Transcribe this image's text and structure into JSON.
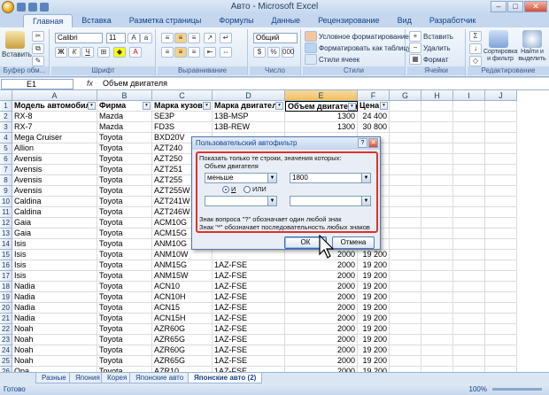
{
  "window": {
    "title": "Авто - Microsoft Excel"
  },
  "ribbon": {
    "tabs": [
      "Главная",
      "Вставка",
      "Разметка страницы",
      "Формулы",
      "Данные",
      "Рецензирование",
      "Вид",
      "Разработчик"
    ],
    "clipboard": {
      "paste": "Вставить",
      "group": "Буфер обм..."
    },
    "font": {
      "name": "Calibri",
      "size": "11",
      "group": "Шрифт"
    },
    "align": {
      "group": "Выравнивание"
    },
    "number": {
      "format": "Общий",
      "group": "Число"
    },
    "styles": {
      "cond": "Условное форматирование",
      "table": "Форматировать как таблицу",
      "cell": "Стили ячеек",
      "group": "Стили"
    },
    "cells": {
      "insert": "Вставить",
      "delete": "Удалить",
      "format": "Формат",
      "group": "Ячейки"
    },
    "edit": {
      "sort": "Сортировка и фильтр",
      "find": "Найти и выделить",
      "group": "Редактирование"
    }
  },
  "formula_bar": {
    "cell": "E1",
    "fx": "fx",
    "value": "Объем двигателя"
  },
  "columns": [
    "A",
    "B",
    "C",
    "D",
    "E",
    "F",
    "G",
    "H",
    "I",
    "J"
  ],
  "headers": [
    "Модель автомобиля",
    "Фирма",
    "Марка кузова",
    "Марка двигателя",
    "Объем двигателя",
    "Цена"
  ],
  "rows": [
    [
      "RX-8",
      "Mazda",
      "SE3P",
      "13B-MSP",
      "1300",
      "24 400"
    ],
    [
      "RX-7",
      "Mazda",
      "FD3S",
      "13B-REW",
      "1300",
      "30 800"
    ],
    [
      "Mega Cruiser",
      "Toyota",
      "BXD20V",
      "",
      "",
      ""
    ],
    [
      "Allion",
      "Toyota",
      "AZT240",
      "",
      "",
      ""
    ],
    [
      "Avensis",
      "Toyota",
      "AZT250",
      "",
      "",
      ""
    ],
    [
      "Avensis",
      "Toyota",
      "AZT251",
      "",
      "",
      ""
    ],
    [
      "Avensis",
      "Toyota",
      "AZT255",
      "",
      "",
      ""
    ],
    [
      "Avensis",
      "Toyota",
      "AZT255W",
      "",
      "",
      ""
    ],
    [
      "Caldina",
      "Toyota",
      "AZT241W",
      "",
      "",
      ""
    ],
    [
      "Caldina",
      "Toyota",
      "AZT246W",
      "",
      "",
      ""
    ],
    [
      "Gaia",
      "Toyota",
      "ACM10G",
      "",
      "",
      ""
    ],
    [
      "Gaia",
      "Toyota",
      "ACM15G",
      "",
      "",
      ""
    ],
    [
      "Isis",
      "Toyota",
      "ANM10G",
      "",
      "",
      ""
    ],
    [
      "Isis",
      "Toyota",
      "ANM10W",
      "",
      "2000",
      "19 200"
    ],
    [
      "Isis",
      "Toyota",
      "ANM15G",
      "1AZ-FSE",
      "2000",
      "19 200"
    ],
    [
      "Isis",
      "Toyota",
      "ANM15W",
      "1AZ-FSE",
      "2000",
      "19 200"
    ],
    [
      "Nadia",
      "Toyota",
      "ACN10",
      "1AZ-FSE",
      "2000",
      "19 200"
    ],
    [
      "Nadia",
      "Toyota",
      "ACN10H",
      "1AZ-FSE",
      "2000",
      "19 200"
    ],
    [
      "Nadia",
      "Toyota",
      "ACN15",
      "1AZ-FSE",
      "2000",
      "19 200"
    ],
    [
      "Nadia",
      "Toyota",
      "ACN15H",
      "1AZ-FSE",
      "2000",
      "19 200"
    ],
    [
      "Noah",
      "Toyota",
      "AZR60G",
      "1AZ-FSE",
      "2000",
      "19 200"
    ],
    [
      "Noah",
      "Toyota",
      "AZR65G",
      "1AZ-FSE",
      "2000",
      "19 200"
    ],
    [
      "Noah",
      "Toyota",
      "AZR60G",
      "1AZ-FSE",
      "2000",
      "19 200"
    ],
    [
      "Noah",
      "Toyota",
      "AZR65G",
      "1AZ-FSE",
      "2000",
      "19 200"
    ],
    [
      "Opa",
      "Toyota",
      "AZR10",
      "1AZ-FSE",
      "2000",
      "19 200"
    ]
  ],
  "sheets": [
    "Разные",
    "Япония",
    "Корея",
    "Японские авто",
    "Японские авто (2)"
  ],
  "status": {
    "ready": "Готово",
    "zoom": "100%"
  },
  "dialog": {
    "title": "Пользовательский автофильтр",
    "show_rows": "Показать только те строки, значения которых:",
    "field": "Объем двигателя",
    "op1": "меньше",
    "val1": "1800",
    "and": "И",
    "or": "ИЛИ",
    "op2": "",
    "val2": "",
    "hint1": "Знак вопроса \"?\" обозначает один любой знак",
    "hint2": "Знак \"*\" обозначает последовательность любых знаков",
    "ok": "ОК",
    "cancel": "Отмена"
  }
}
